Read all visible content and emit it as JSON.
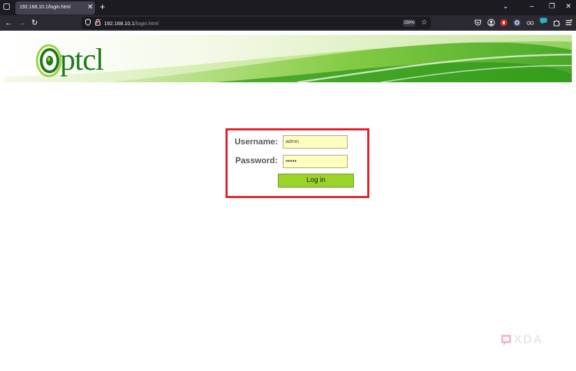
{
  "browser": {
    "tab_title": "192.168.10.1/login.html",
    "tab_close": "✕",
    "new_tab": "+",
    "url_host": "192.168.10.1",
    "url_path": "/login.html",
    "zoom_level": "150%",
    "list_tabs_icon": "⌄",
    "minimize_icon": "–",
    "restore_icon": "❐",
    "close_icon": "✕"
  },
  "banner": {
    "logo_text": "ptcl",
    "colors": {
      "green_dark": "#1d7a1a",
      "green_light": "#8fd13a"
    }
  },
  "login": {
    "username_label": "Username:",
    "username_value": "admin",
    "password_label": "Password:",
    "password_value": "•••••",
    "login_button": "Log in",
    "highlight_color": "#e21d27"
  },
  "watermark": {
    "text": "XDA"
  }
}
